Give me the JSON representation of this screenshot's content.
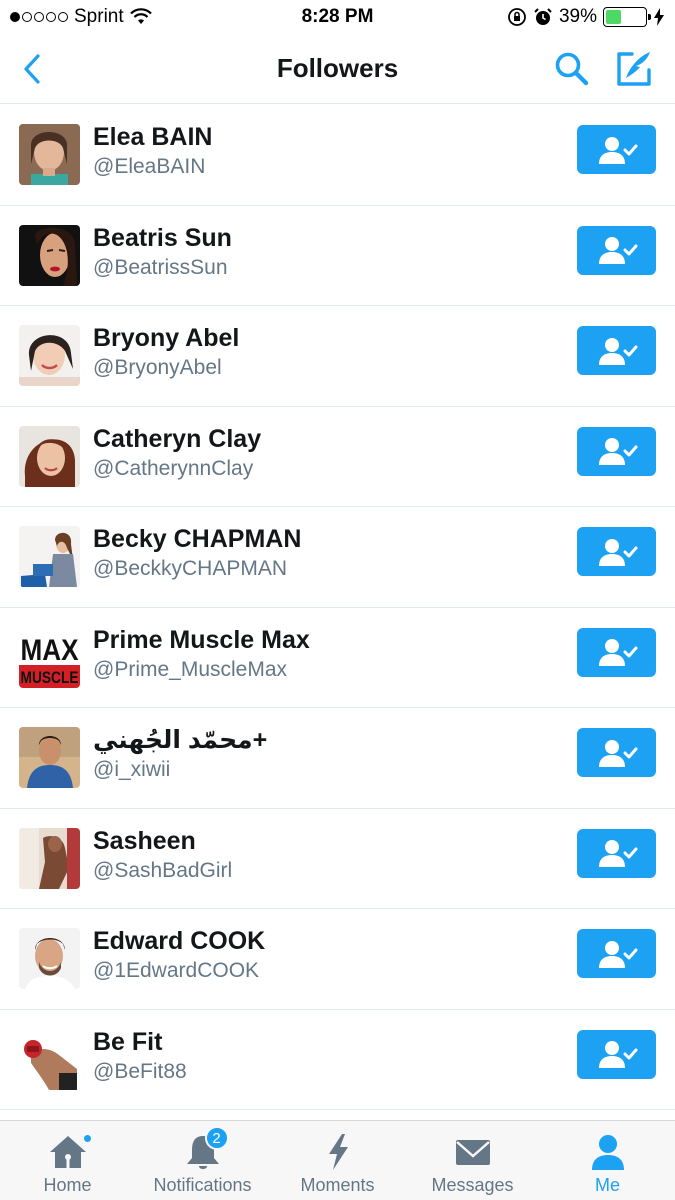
{
  "status_bar": {
    "carrier": "Sprint",
    "time": "8:28 PM",
    "battery_percent": "39%",
    "battery_level": 0.39,
    "signal_bars_filled": 1,
    "signal_bars_total": 5
  },
  "header": {
    "title": "Followers"
  },
  "followers": [
    {
      "name": "Elea BAIN",
      "handle": "@EleaBAIN",
      "avatar": "portrait-woman-teal-top"
    },
    {
      "name": "Beatris Sun",
      "handle": "@BeatrissSun",
      "avatar": "portrait-woman-dark-background"
    },
    {
      "name": "Bryony Abel",
      "handle": "@BryonyAbel",
      "avatar": "portrait-woman-smiling"
    },
    {
      "name": "Catheryn Clay",
      "handle": "@CatherynnClay",
      "avatar": "portrait-woman-auburn-hair"
    },
    {
      "name": "Becky CHAPMAN",
      "handle": "@BeckkyCHAPMAN",
      "avatar": "woman-reading-book"
    },
    {
      "name": "Prime Muscle Max",
      "handle": "@Prime_MuscleMax",
      "avatar": "max-muscle-logo",
      "logo_text": [
        "MAX",
        "MUSCLE"
      ]
    },
    {
      "name": "محمّد الجُهني+",
      "handle": "@i_xiwii",
      "avatar": "portrait-man-blue-shirt"
    },
    {
      "name": "Sasheen",
      "handle": "@SashBadGirl",
      "avatar": "photo-woman-room"
    },
    {
      "name": "Edward COOK",
      "handle": "@1EdwardCOOK",
      "avatar": "portrait-man-smiling"
    },
    {
      "name": "Be Fit",
      "handle": "@BeFit88",
      "avatar": "fitness-arm-dumbbell"
    }
  ],
  "tabbar": {
    "tabs": [
      {
        "label": "Home",
        "icon": "home-icon",
        "has_dot": true
      },
      {
        "label": "Notifications",
        "icon": "bell-icon",
        "badge": "2"
      },
      {
        "label": "Moments",
        "icon": "lightning-icon"
      },
      {
        "label": "Messages",
        "icon": "envelope-icon"
      },
      {
        "label": "Me",
        "icon": "person-icon",
        "active": true
      }
    ]
  },
  "colors": {
    "accent": "#1da1f2",
    "text_primary": "#14171a",
    "text_secondary": "#657786",
    "divider": "#e1e8ed",
    "battery": "#4cd964"
  }
}
